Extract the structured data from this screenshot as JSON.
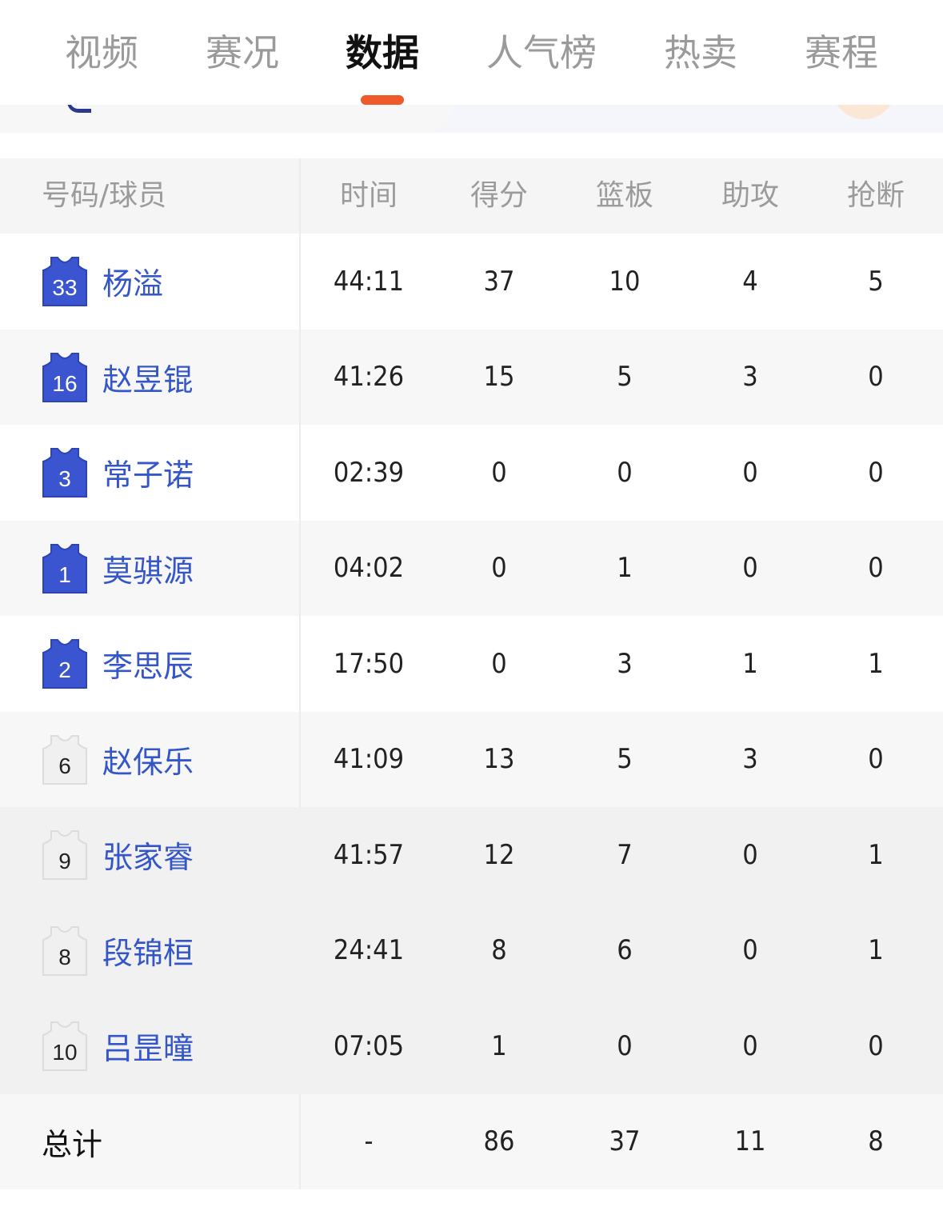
{
  "tabs": [
    {
      "label": "视频",
      "active": false
    },
    {
      "label": "赛况",
      "active": false
    },
    {
      "label": "数据",
      "active": true
    },
    {
      "label": "人气榜",
      "active": false
    },
    {
      "label": "热卖",
      "active": false
    },
    {
      "label": "赛程",
      "active": false
    }
  ],
  "colors": {
    "accent": "#f0592a",
    "player_name": "#3456c9",
    "jersey_blue": "#3b55d0",
    "jersey_white": "#f0f0f0"
  },
  "table": {
    "headers": {
      "player": "号码/球员",
      "time": "时间",
      "pts": "得分",
      "reb": "篮板",
      "ast": "助攻",
      "stl": "抢断"
    },
    "players": [
      {
        "number": "33",
        "name": "杨溢",
        "time": "44:11",
        "pts": "37",
        "reb": "10",
        "ast": "4",
        "stl": "5",
        "jersey": "blue"
      },
      {
        "number": "16",
        "name": "赵昱锟",
        "time": "41:26",
        "pts": "15",
        "reb": "5",
        "ast": "3",
        "stl": "0",
        "jersey": "blue"
      },
      {
        "number": "3",
        "name": "常子诺",
        "time": "02:39",
        "pts": "0",
        "reb": "0",
        "ast": "0",
        "stl": "0",
        "jersey": "blue"
      },
      {
        "number": "1",
        "name": "莫骐源",
        "time": "04:02",
        "pts": "0",
        "reb": "1",
        "ast": "0",
        "stl": "0",
        "jersey": "blue"
      },
      {
        "number": "2",
        "name": "李思辰",
        "time": "17:50",
        "pts": "0",
        "reb": "3",
        "ast": "1",
        "stl": "1",
        "jersey": "blue"
      },
      {
        "number": "6",
        "name": "赵保乐",
        "time": "41:09",
        "pts": "13",
        "reb": "5",
        "ast": "3",
        "stl": "0",
        "jersey": "white"
      },
      {
        "number": "9",
        "name": "张家睿",
        "time": "41:57",
        "pts": "12",
        "reb": "7",
        "ast": "0",
        "stl": "1",
        "jersey": "white"
      },
      {
        "number": "8",
        "name": "段锦桓",
        "time": "24:41",
        "pts": "8",
        "reb": "6",
        "ast": "0",
        "stl": "1",
        "jersey": "white"
      },
      {
        "number": "10",
        "name": "吕昰曈",
        "time": "07:05",
        "pts": "1",
        "reb": "0",
        "ast": "0",
        "stl": "0",
        "jersey": "white"
      }
    ],
    "total": {
      "label": "总计",
      "time": "-",
      "pts": "86",
      "reb": "37",
      "ast": "11",
      "stl": "8"
    }
  }
}
